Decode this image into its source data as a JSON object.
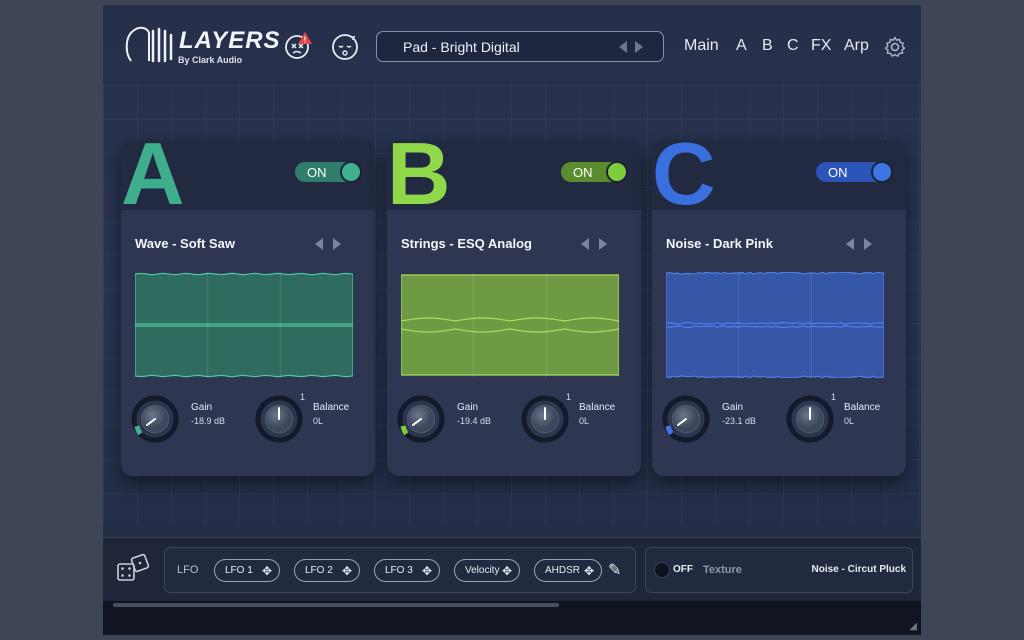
{
  "header": {
    "logo_wordmark": "LAYERS",
    "logo_sub": "By Clark Audio",
    "preset_name": "Pad - Bright Digital",
    "nav": [
      "Main",
      "A",
      "B",
      "C",
      "FX",
      "Arp"
    ],
    "icons": [
      "logo-icon",
      "chaos-warning-icon",
      "sleeping-face-icon",
      "prev-arrow-icon",
      "next-arrow-icon",
      "gear-icon"
    ]
  },
  "layers": [
    {
      "letter": "A",
      "color": "#3fae8c",
      "toggle": "ON",
      "toggle_color": "#2f7d6a",
      "knob_color": "#3fb08e",
      "name": "Wave - Soft Saw",
      "wave_fill": "#2f6b5e",
      "wave_stroke": "#4ec8a4",
      "gain_label": "Gain",
      "gain_value": "-18.9 dB",
      "balance_label": "Balance",
      "balance_value": "0L",
      "balance_mark": "1"
    },
    {
      "letter": "B",
      "color": "#8ed84a",
      "toggle": "ON",
      "toggle_color": "#5b8c2e",
      "knob_color": "#7ccc3e",
      "name": "Strings - ESQ Analog",
      "wave_fill": "#6e9a44",
      "wave_stroke": "#a5e060",
      "gain_label": "Gain",
      "gain_value": "-19.4 dB",
      "balance_label": "Balance",
      "balance_value": "0L",
      "balance_mark": "1"
    },
    {
      "letter": "C",
      "color": "#3a6fe0",
      "toggle": "ON",
      "toggle_color": "#2b55b8",
      "knob_color": "#3f76e6",
      "name": "Noise - Dark Pink",
      "wave_fill": "#3656a8",
      "wave_stroke": "#4e7fe8",
      "gain_label": "Gain",
      "gain_value": "-23.1 dB",
      "balance_label": "Balance",
      "balance_value": "0L",
      "balance_mark": "1"
    }
  ],
  "bottom": {
    "lfo_title": "LFO",
    "mod_sources": [
      "LFO 1",
      "LFO 2",
      "LFO 3",
      "Velocity",
      "AHDSR"
    ],
    "texture_toggle": "OFF",
    "texture_label": "Texture",
    "texture_preset": "Noise - Circut Pluck"
  }
}
